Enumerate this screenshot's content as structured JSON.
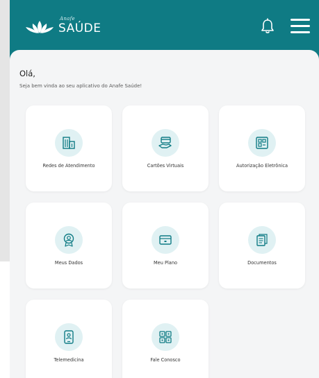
{
  "header": {
    "logo_small": "Anafe",
    "logo_text": "SAÚDE",
    "bell_icon": "bell-icon",
    "menu_icon": "hamburger-menu-icon"
  },
  "greeting": {
    "title": "Olá,",
    "subtitle": "Seja bem vinda ao seu aplicativo do Anafe Saúde!"
  },
  "cards": [
    {
      "label": "Redes de Atendimento",
      "icon": "building-icon"
    },
    {
      "label": "Cartões Virtuais",
      "icon": "card-hand-icon"
    },
    {
      "label": "Autorização Eletrônica",
      "icon": "authorization-icon"
    },
    {
      "label": "Meus Dados",
      "icon": "user-badge-icon"
    },
    {
      "label": "Meu Plano",
      "icon": "plan-card-icon"
    },
    {
      "label": "Documentos",
      "icon": "documents-icon"
    },
    {
      "label": "Telemedicina",
      "icon": "phone-doctor-icon"
    },
    {
      "label": "Fale Conosco",
      "icon": "qr-contact-icon"
    }
  ],
  "colors": {
    "brand": "#0f7b84",
    "icon_bg": "#e0f1f3",
    "icon_stroke": "#0f7b84",
    "page_bg": "#f4f5f6"
  }
}
